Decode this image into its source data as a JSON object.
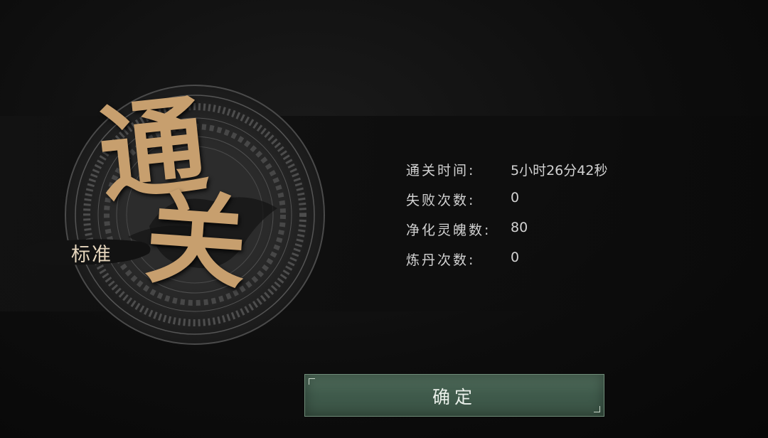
{
  "result": {
    "title_char_1": "通",
    "title_char_2": "关",
    "mode": "标准"
  },
  "stats": [
    {
      "label": "通关时间:",
      "value": "5小时26分42秒"
    },
    {
      "label": "失败次数:",
      "value": "0"
    },
    {
      "label": "净化灵魄数:",
      "value": "80"
    },
    {
      "label": "炼丹次数:",
      "value": "0"
    }
  ],
  "confirm": {
    "label": "确定"
  },
  "colors": {
    "gold": "#c79f6e",
    "button_green": "#4a6555",
    "text": "#d2d2d2"
  }
}
